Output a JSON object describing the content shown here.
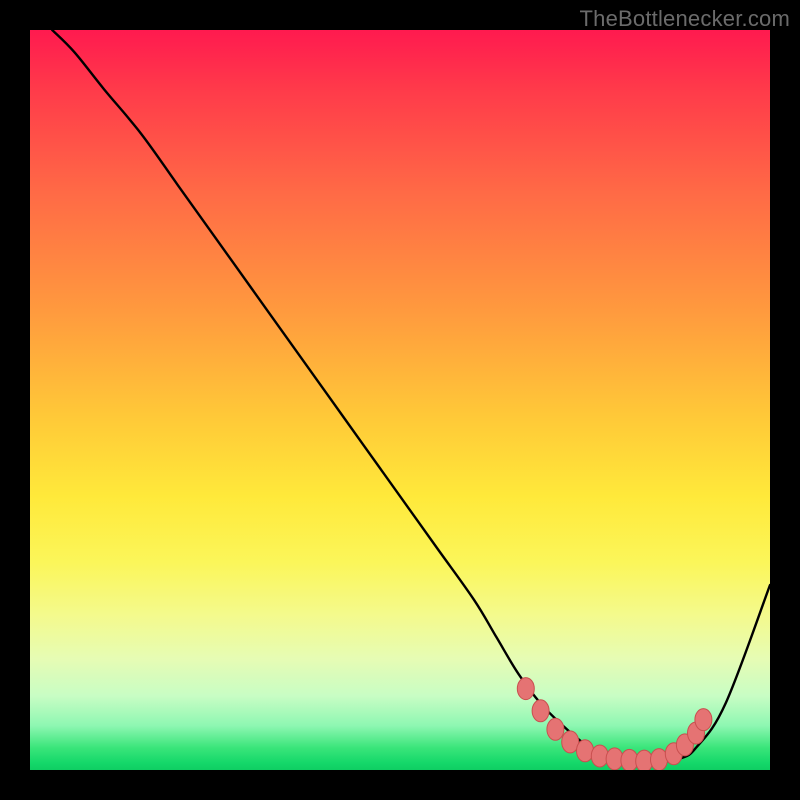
{
  "attribution": "TheBottlenecker.com",
  "colors": {
    "frame": "#000000",
    "curve": "#000000",
    "markers_fill": "#e57373",
    "markers_stroke": "#c94f4f",
    "gradient_top": "#ff1a4f",
    "gradient_bottom": "#0fce63"
  },
  "chart_data": {
    "type": "line",
    "title": "",
    "xlabel": "",
    "ylabel": "",
    "xlim": [
      0,
      100
    ],
    "ylim": [
      0,
      100
    ],
    "series": [
      {
        "name": "bottleneck-curve",
        "x": [
          3,
          6,
          10,
          15,
          20,
          25,
          30,
          35,
          40,
          45,
          50,
          55,
          60,
          63,
          66,
          69,
          72,
          75,
          78,
          81,
          84,
          86,
          88,
          90,
          94,
          100
        ],
        "y": [
          100,
          97,
          92,
          86,
          79,
          72,
          65,
          58,
          51,
          44,
          37,
          30,
          23,
          18,
          13,
          9,
          6,
          3.5,
          2,
          1.3,
          1.1,
          1.2,
          1.6,
          3,
          9,
          25
        ]
      }
    ],
    "markers": {
      "name": "optimal-range",
      "points": [
        {
          "x": 67,
          "y": 11
        },
        {
          "x": 69,
          "y": 8
        },
        {
          "x": 71,
          "y": 5.5
        },
        {
          "x": 73,
          "y": 3.8
        },
        {
          "x": 75,
          "y": 2.6
        },
        {
          "x": 77,
          "y": 1.9
        },
        {
          "x": 79,
          "y": 1.5
        },
        {
          "x": 81,
          "y": 1.3
        },
        {
          "x": 83,
          "y": 1.2
        },
        {
          "x": 85,
          "y": 1.4
        },
        {
          "x": 87,
          "y": 2.2
        },
        {
          "x": 88.5,
          "y": 3.4
        },
        {
          "x": 90,
          "y": 5
        },
        {
          "x": 91,
          "y": 6.8
        }
      ]
    }
  }
}
